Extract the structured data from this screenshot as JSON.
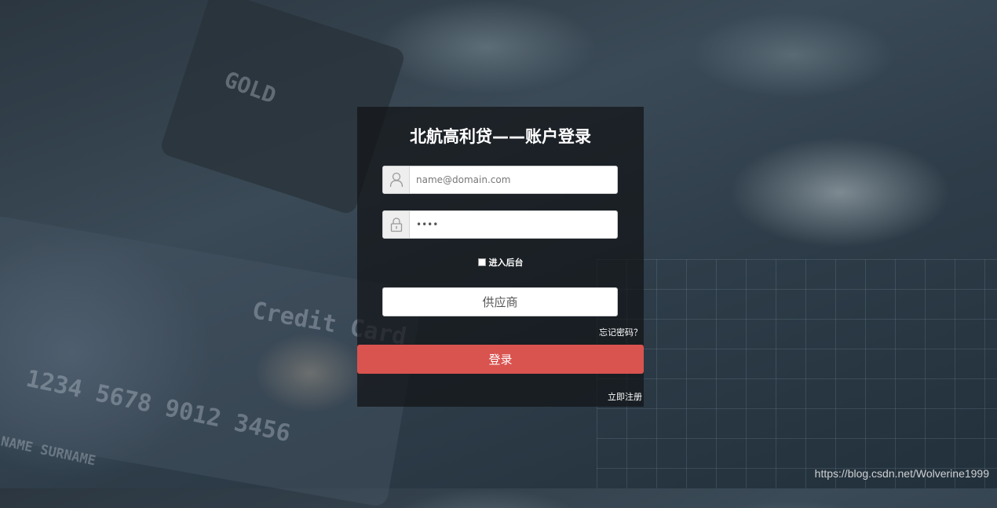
{
  "background": {
    "card_texts": {
      "gold": "GOLD",
      "credit_card": "Credit Card",
      "number": "1234 5678 9012 3456",
      "surname": "NAME SURNAME"
    }
  },
  "login": {
    "title": "北航高利贷——账户登录",
    "email_placeholder": "name@domain.com",
    "password_value": "••••",
    "backend_checkbox_label": "进入后台",
    "backend_checked": false,
    "role_value": "供应商",
    "forgot_password": "忘记密码？",
    "login_button": "登录",
    "register_link": "立即注册"
  },
  "watermark": "https://blog.csdn.net/Wolverine1999",
  "colors": {
    "panel_bg": "#121416",
    "login_button": "#d9534f",
    "text_on_dark": "#ffffff"
  },
  "icons": {
    "user": "user-icon",
    "lock": "lock-icon"
  }
}
